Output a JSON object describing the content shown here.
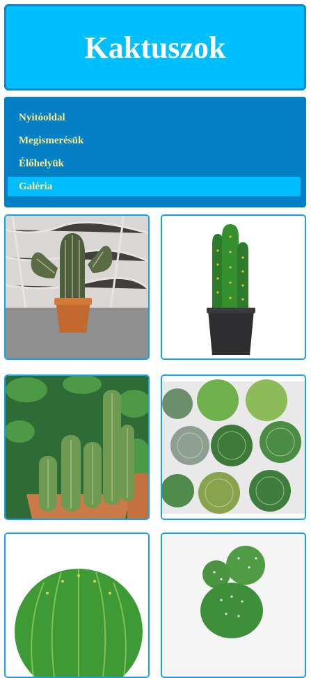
{
  "header": {
    "title": "Kaktuszok"
  },
  "nav": {
    "items": [
      {
        "label": "Nyitóoldal"
      },
      {
        "label": "Megismerésük"
      },
      {
        "label": "Élőhelyük"
      },
      {
        "label": "Galéria"
      }
    ],
    "active_index": 3
  },
  "colors": {
    "header_bg": "#00bfff",
    "nav_bg": "#0380c6",
    "nav_text": "#ffe98a",
    "nav_active_bg": "#00bfff",
    "tile_border": "#12a3e6"
  },
  "gallery": {
    "images": [
      {
        "subject": "cactus-photo-terracotta-pot"
      },
      {
        "subject": "cactus-photo-black-pot"
      },
      {
        "subject": "cactus-photo-group-columnar"
      },
      {
        "subject": "cactus-photo-succulent-assortment"
      },
      {
        "subject": "cactus-photo-round-golden-barrel"
      },
      {
        "subject": "cactus-photo-small-globular"
      }
    ]
  }
}
